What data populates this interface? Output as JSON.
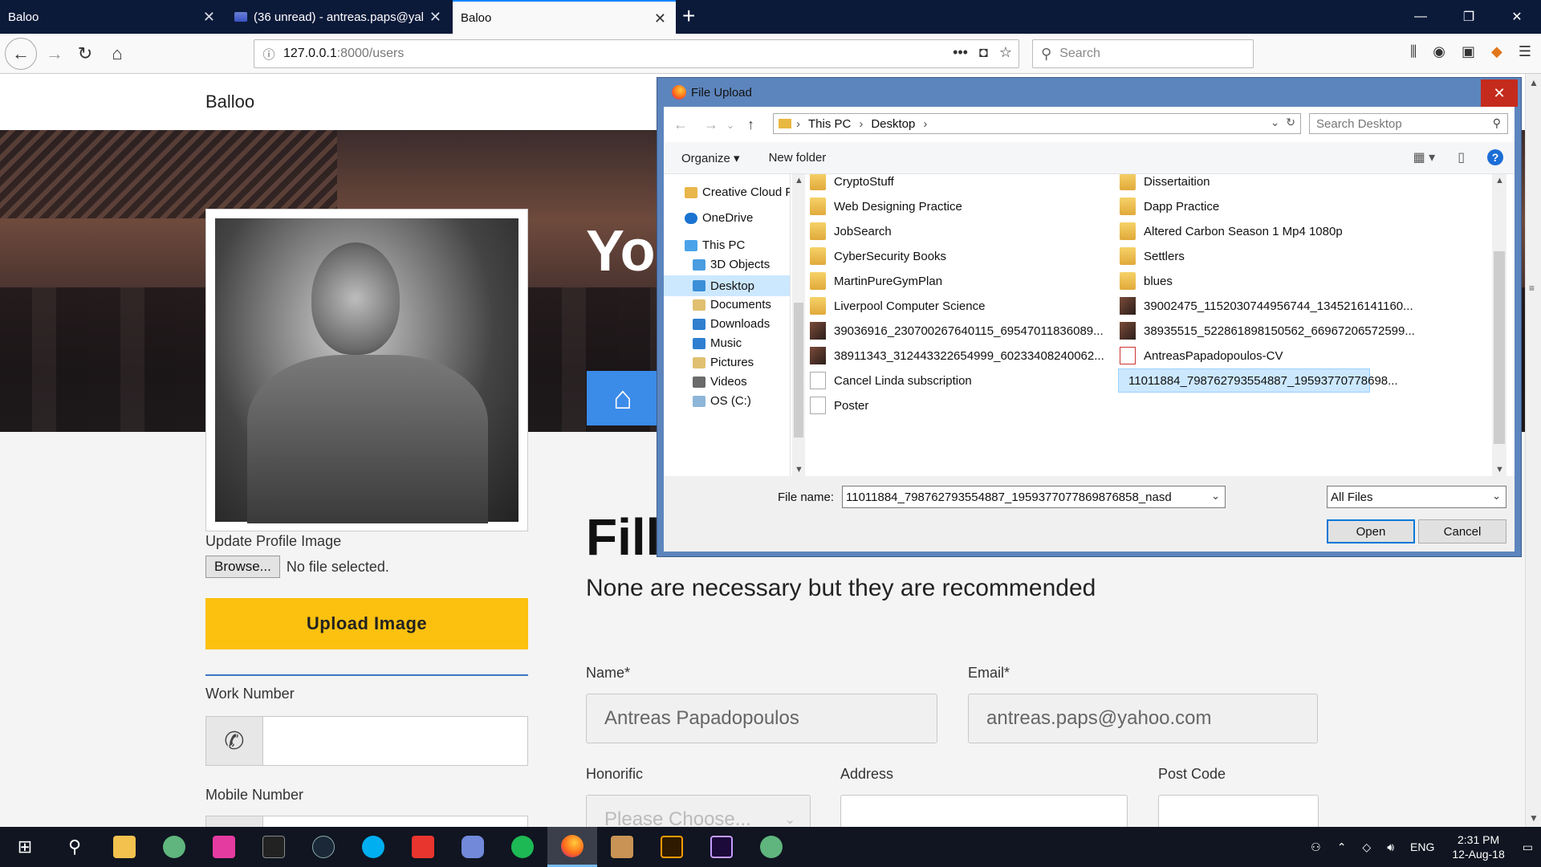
{
  "browser": {
    "tabs": [
      {
        "label": "Baloo"
      },
      {
        "label": "(36 unread) - antreas.paps@yal"
      },
      {
        "label": "Baloo"
      }
    ],
    "url_host": "127.0.0.1",
    "url_path": ":8000/users",
    "search_placeholder": "Search"
  },
  "page": {
    "brand": "Balloo",
    "hero_title": "Yo",
    "update_label": "Update Profile Image",
    "browse_label": "Browse...",
    "no_file": "No file selected.",
    "upload_label": "Upload Image",
    "work_number_label": "Work Number",
    "mobile_number_label": "Mobile Number",
    "fill_title": "Fill",
    "fill_subtitle": "None are necessary but they are recommended",
    "name_label": "Name*",
    "name_value": "Antreas Papadopoulos",
    "email_label": "Email*",
    "email_value": "antreas.paps@yahoo.com",
    "honorific_label": "Honorific",
    "honorific_placeholder": "Please Choose...",
    "address_label": "Address",
    "postcode_label": "Post Code"
  },
  "dialog": {
    "title": "File Upload",
    "breadcrumb": [
      "This PC",
      "Desktop"
    ],
    "search_placeholder": "Search Desktop",
    "organize": "Organize",
    "new_folder": "New folder",
    "tree": [
      {
        "label": "Creative Cloud File",
        "icon": "creative-cloud-icon"
      },
      {
        "label": "OneDrive",
        "icon": "onedrive-icon"
      },
      {
        "label": "This PC",
        "icon": "computer-icon"
      },
      {
        "label": "3D Objects",
        "icon": "folder-icon"
      },
      {
        "label": "Desktop",
        "icon": "folder-icon",
        "selected": true
      },
      {
        "label": "Documents",
        "icon": "folder-icon"
      },
      {
        "label": "Downloads",
        "icon": "folder-icon"
      },
      {
        "label": "Music",
        "icon": "folder-icon"
      },
      {
        "label": "Pictures",
        "icon": "folder-icon"
      },
      {
        "label": "Videos",
        "icon": "folder-icon"
      },
      {
        "label": "OS (C:)",
        "icon": "drive-icon"
      }
    ],
    "files_left": [
      {
        "label": "CryptoStuff",
        "type": "folder"
      },
      {
        "label": "Web Designing Practice",
        "type": "folder"
      },
      {
        "label": "JobSearch",
        "type": "folder"
      },
      {
        "label": "CyberSecurity Books",
        "type": "folder"
      },
      {
        "label": "MartinPureGymPlan",
        "type": "folder"
      },
      {
        "label": "Liverpool Computer Science",
        "type": "folder"
      },
      {
        "label": "39036916_230700267640115_69547011836089...",
        "type": "image"
      },
      {
        "label": "38911343_312443322654999_60233408240062...",
        "type": "image"
      },
      {
        "label": "Cancel Linda subscription",
        "type": "doc"
      },
      {
        "label": "Poster",
        "type": "doc"
      }
    ],
    "files_right": [
      {
        "label": "Dissertaition",
        "type": "folder"
      },
      {
        "label": "Dapp Practice",
        "type": "folder"
      },
      {
        "label": "Altered Carbon Season 1 Mp4 1080p",
        "type": "folder"
      },
      {
        "label": "Settlers",
        "type": "folder"
      },
      {
        "label": "blues",
        "type": "folder"
      },
      {
        "label": "39002475_1152030744956744_1345216141160...",
        "type": "image"
      },
      {
        "label": "38935515_522861898150562_66967206572599...",
        "type": "image"
      },
      {
        "label": "AntreasPapadopoulos-CV",
        "type": "pdf"
      },
      {
        "label": "11011884_798762793554887_19593770778698...",
        "type": "image",
        "selected": true
      }
    ],
    "file_name_label": "File name:",
    "file_name_value": "11011884_798762793554887_1959377077869876858_nasd",
    "file_type": "All Files",
    "open_label": "Open",
    "cancel_label": "Cancel"
  },
  "taskbar": {
    "time": "2:31 PM",
    "date": "12-Aug-18",
    "lang": "ENG"
  }
}
